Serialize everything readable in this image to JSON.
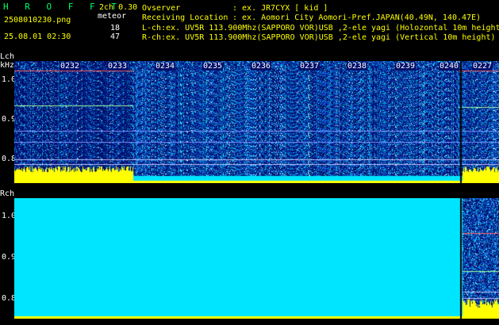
{
  "app": {
    "title": "H R O F F T",
    "version": "2ch 0.30",
    "filename": "2508010230.png",
    "datetime": "25.08.01 02:30",
    "meteor_label": "meteor",
    "lch_count": "18",
    "rch_count": "47"
  },
  "info": {
    "observer_label": "Ovserver",
    "observer_value": ": ex. JR7CYX [ kid ]",
    "location_label": "Receiving Location",
    "location_value": ": ex. Aomori City Aomori-Pref.JAPAN(40.49N, 140.47E)",
    "lch_line": "L-ch:ex. UV5R 113.900Mhz(SAPPORO VOR)USB ,2-ele yagi (Holozontal 10m height)",
    "rch_line": "R-ch:ex. UV5R 113.900Mhz(SAPPORO VOR)USB ,2-ele yagi (Vertical 10m height)"
  },
  "lch": {
    "label": "Lch",
    "unit": "kHz",
    "yticks": [
      "1.0",
      "0.9",
      "0.8"
    ]
  },
  "rch": {
    "label": "Rch",
    "yticks": [
      "1.0",
      "0.9",
      "0.8"
    ]
  },
  "time_ticks": [
    "0232",
    "0233",
    "0234",
    "0235",
    "0236",
    "0237",
    "0238",
    "0239",
    "0240",
    "0227"
  ],
  "colors": {
    "background": "#00106a",
    "noise": "#1a40d0",
    "signal": "#00e5ff",
    "level_yellow": "#ffff00",
    "level_cyan": "#00e5ff",
    "header_green": "#00ff66"
  }
}
